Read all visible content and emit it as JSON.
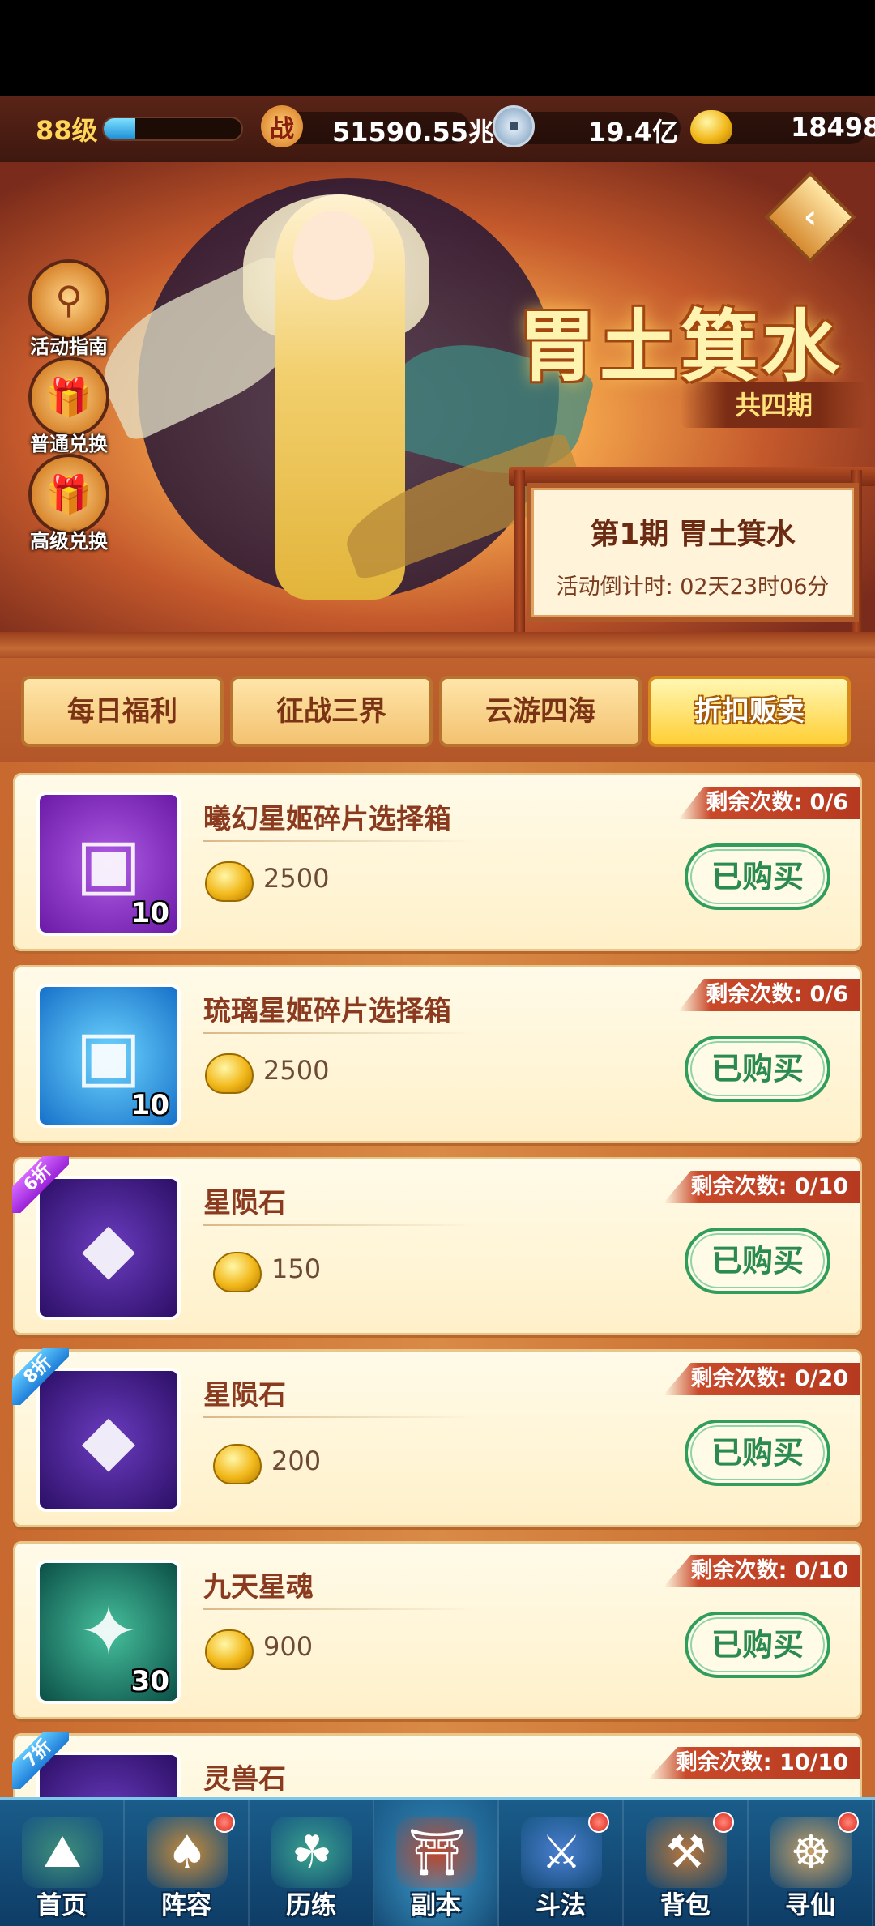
{
  "resources": {
    "level": "88级",
    "xp_fraction": 0.23,
    "power_icon": "战",
    "power": "51590.55兆",
    "coin": "19.4亿",
    "gold": "18498"
  },
  "side_buttons": [
    "活动指南",
    "普通兑换",
    "高级兑换"
  ],
  "banner": {
    "title": "胃土箕水",
    "subtitle": "共四期",
    "period_title": "第1期  胃土箕水",
    "countdown": "活动倒计时: 02天23时06分"
  },
  "tabs": [
    "每日福利",
    "征战三界",
    "云游四海",
    "折扣贩卖"
  ],
  "active_tab": 3,
  "items": [
    {
      "name": "曦幻星姬碎片选择箱",
      "price": "2500",
      "remain": "剩余次数: 0/6",
      "qty": "10",
      "discount": "",
      "button": "已购买",
      "color": "purple",
      "icon": "treasure-chest-icon"
    },
    {
      "name": "琉璃星姬碎片选择箱",
      "price": "2500",
      "remain": "剩余次数: 0/6",
      "qty": "10",
      "discount": "",
      "button": "已购买",
      "color": "blue",
      "icon": "treasure-chest-icon"
    },
    {
      "name": "星陨石",
      "price": "150",
      "remain": "剩余次数: 0/10",
      "qty": "",
      "discount": "6折",
      "button": "已购买",
      "color": "violet",
      "icon": "crystal-icon"
    },
    {
      "name": "星陨石",
      "price": "200",
      "remain": "剩余次数: 0/20",
      "qty": "",
      "discount": "8折",
      "button": "已购买",
      "color": "violet",
      "icon": "crystal-icon"
    },
    {
      "name": "九天星魂",
      "price": "900",
      "remain": "剩余次数: 0/10",
      "qty": "30",
      "discount": "",
      "button": "已购买",
      "color": "green",
      "icon": "star-orb-icon"
    },
    {
      "name": "灵兽石",
      "price": "",
      "remain": "剩余次数: 10/10",
      "qty": "",
      "discount": "7折",
      "button": "",
      "color": "violet",
      "icon": "beast-stone-icon"
    }
  ],
  "nav": [
    {
      "label": "首页",
      "dot": false
    },
    {
      "label": "阵容",
      "dot": true
    },
    {
      "label": "历练",
      "dot": false
    },
    {
      "label": "副本",
      "dot": false
    },
    {
      "label": "斗法",
      "dot": true
    },
    {
      "label": "背包",
      "dot": true
    },
    {
      "label": "寻仙",
      "dot": true
    }
  ],
  "colors": {
    "accent": "#ffcf35",
    "bought_green": "#2f9d5b",
    "remain_red": "#c9492a"
  }
}
